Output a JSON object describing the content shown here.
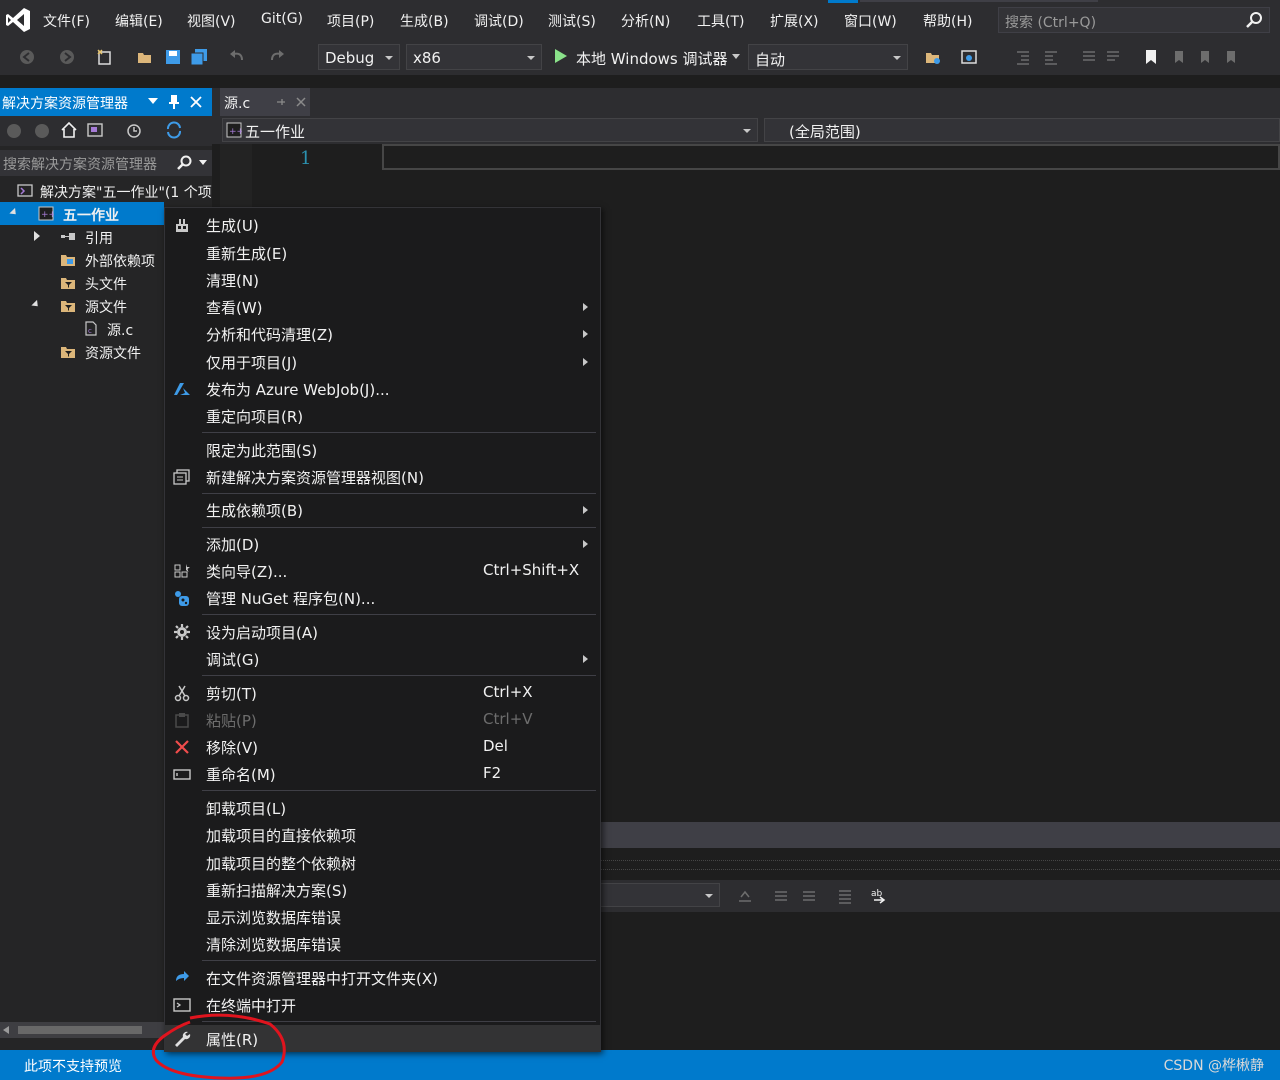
{
  "menubar": {
    "items": [
      "文件(F)",
      "编辑(E)",
      "视图(V)",
      "Git(G)",
      "项目(P)",
      "生成(B)",
      "调试(D)",
      "测试(S)",
      "分析(N)",
      "工具(T)",
      "扩展(X)",
      "窗口(W)",
      "帮助(H)"
    ],
    "search_placeholder": "搜索 (Ctrl+Q)"
  },
  "toolbar": {
    "config": "Debug",
    "platform": "x86",
    "run_label": "本地 Windows 调试器",
    "auto": "自动"
  },
  "solution_explorer": {
    "title": "解决方案资源管理器",
    "search_placeholder": "搜索解决方案资源管理器",
    "tree": {
      "solution": "解决方案\"五一作业\"(1 个项",
      "project": "五一作业",
      "references": "引用",
      "external_deps": "外部依赖项",
      "header_files": "头文件",
      "source_files": "源文件",
      "source_c": "源.c",
      "resource_files": "资源文件"
    }
  },
  "editor": {
    "tab_label": "源.c",
    "nav_project": "五一作业",
    "nav_scope": "(全局范围)",
    "line_number": "1"
  },
  "context_menu": {
    "items": [
      {
        "label": "生成(U)",
        "shortcut": "",
        "icon": "build-icon"
      },
      {
        "label": "重新生成(E)",
        "shortcut": ""
      },
      {
        "label": "清理(N)",
        "shortcut": ""
      },
      {
        "label": "查看(W)",
        "shortcut": ""
      },
      {
        "label": "分析和代码清理(Z)",
        "shortcut": ""
      },
      {
        "label": "仅用于项目(J)",
        "shortcut": ""
      },
      {
        "label": "发布为 Azure WebJob(J)...",
        "shortcut": "",
        "icon": "azure-icon"
      },
      {
        "label": "重定向项目(R)",
        "shortcut": ""
      },
      {
        "label": "限定为此范围(S)",
        "shortcut": ""
      },
      {
        "label": "新建解决方案资源管理器视图(N)",
        "shortcut": "",
        "icon": "new-view-icon"
      },
      {
        "label": "生成依赖项(B)",
        "shortcut": ""
      },
      {
        "label": "添加(D)",
        "shortcut": ""
      },
      {
        "label": "类向导(Z)...",
        "shortcut": "Ctrl+Shift+X",
        "icon": "class-wizard-icon"
      },
      {
        "label": "管理 NuGet 程序包(N)...",
        "shortcut": "",
        "icon": "nuget-icon"
      },
      {
        "label": "设为启动项目(A)",
        "shortcut": "",
        "icon": "gear-icon"
      },
      {
        "label": "调试(G)",
        "shortcut": ""
      },
      {
        "label": "剪切(T)",
        "shortcut": "Ctrl+X",
        "icon": "scissors-icon"
      },
      {
        "label": "粘贴(P)",
        "shortcut": "Ctrl+V",
        "icon": "paste-icon"
      },
      {
        "label": "移除(V)",
        "shortcut": "Del",
        "icon": "remove-icon"
      },
      {
        "label": "重命名(M)",
        "shortcut": "F2",
        "icon": "rename-icon"
      },
      {
        "label": "卸载项目(L)",
        "shortcut": ""
      },
      {
        "label": "加载项目的直接依赖项",
        "shortcut": ""
      },
      {
        "label": "加载项目的整个依赖树",
        "shortcut": ""
      },
      {
        "label": "重新扫描解决方案(S)",
        "shortcut": ""
      },
      {
        "label": "显示浏览数据库错误",
        "shortcut": ""
      },
      {
        "label": "清除浏览数据库错误",
        "shortcut": ""
      },
      {
        "label": "在文件资源管理器中打开文件夹(X)",
        "shortcut": "",
        "icon": "open-folder-icon"
      },
      {
        "label": "在终端中打开",
        "shortcut": "",
        "icon": "terminal-icon"
      },
      {
        "label": "属性(R)",
        "shortcut": "",
        "icon": "wrench-icon"
      }
    ]
  },
  "statusbar": {
    "message": "此项不支持预览",
    "watermark": "CSDN @桦楸静"
  },
  "colors": {
    "accent": "#007acc",
    "annotation_red": "#e0141e"
  }
}
